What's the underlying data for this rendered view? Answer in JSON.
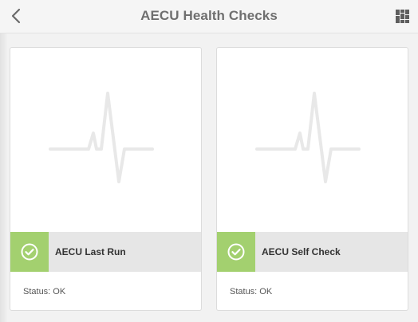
{
  "header": {
    "title": "AECU Health Checks",
    "back_icon": "chevron-left-icon",
    "view_icon": "card-view-icon"
  },
  "cards": [
    {
      "name": "AECU Last Run",
      "status_text": "Status: OK",
      "status_icon": "check-circle-icon",
      "thumbnail_icon": "heartbeat-icon"
    },
    {
      "name": "AECU Self Check",
      "status_text": "Status: OK",
      "status_icon": "check-circle-icon",
      "thumbnail_icon": "heartbeat-icon"
    }
  ],
  "colors": {
    "status_ok": "#a3d06f",
    "bar_background": "#e6e6e6",
    "page_background": "#f2f2f2"
  }
}
